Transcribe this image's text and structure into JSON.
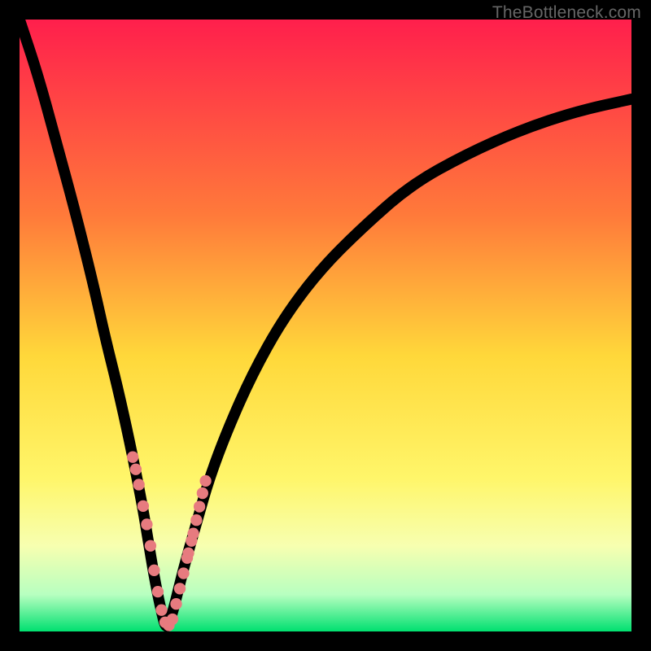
{
  "watermark": "TheBottleneck.com",
  "colors": {
    "frame": "#000000",
    "gradient_stops": [
      {
        "offset": 0.0,
        "color": "#ff1f4c"
      },
      {
        "offset": 0.32,
        "color": "#ff7a3a"
      },
      {
        "offset": 0.55,
        "color": "#ffd83a"
      },
      {
        "offset": 0.75,
        "color": "#fff66a"
      },
      {
        "offset": 0.86,
        "color": "#f7ffb0"
      },
      {
        "offset": 0.94,
        "color": "#b7ffc0"
      },
      {
        "offset": 1.0,
        "color": "#00e070"
      }
    ],
    "curve": "#000000",
    "marker": "#e77b7f"
  },
  "chart_data": {
    "type": "line",
    "title": "",
    "xlabel": "",
    "ylabel": "",
    "xlim": [
      0,
      100
    ],
    "ylim": [
      0,
      100
    ],
    "x_min_at": 24,
    "series": [
      {
        "name": "bottleneck-curve",
        "x": [
          0,
          3,
          6,
          9,
          12,
          14,
          16,
          18,
          20,
          21,
          22,
          23,
          24,
          25,
          26,
          27,
          29,
          31,
          34,
          38,
          43,
          49,
          56,
          64,
          73,
          82,
          91,
          100
        ],
        "values": [
          100,
          91,
          80,
          69,
          57,
          48,
          40,
          31,
          21,
          15,
          9,
          4,
          0,
          3,
          7,
          11,
          18,
          25,
          33,
          42,
          51,
          59,
          66,
          73,
          78,
          82,
          85,
          87
        ]
      }
    ],
    "markers": {
      "name": "highlight-points",
      "x": [
        18.5,
        19.0,
        19.5,
        20.2,
        20.8,
        21.4,
        22.0,
        22.6,
        23.2,
        23.8,
        24.4,
        25.0,
        25.6,
        26.2,
        26.8,
        27.4,
        27.6,
        28.1,
        28.4,
        28.9,
        29.4,
        29.9,
        30.4
      ],
      "values": [
        28.5,
        26.5,
        24.0,
        20.5,
        17.5,
        14.0,
        10.0,
        6.5,
        3.5,
        1.5,
        1.0,
        2.0,
        4.5,
        7.0,
        9.5,
        12.0,
        12.8,
        14.8,
        16.0,
        18.2,
        20.4,
        22.6,
        24.6
      ]
    }
  }
}
